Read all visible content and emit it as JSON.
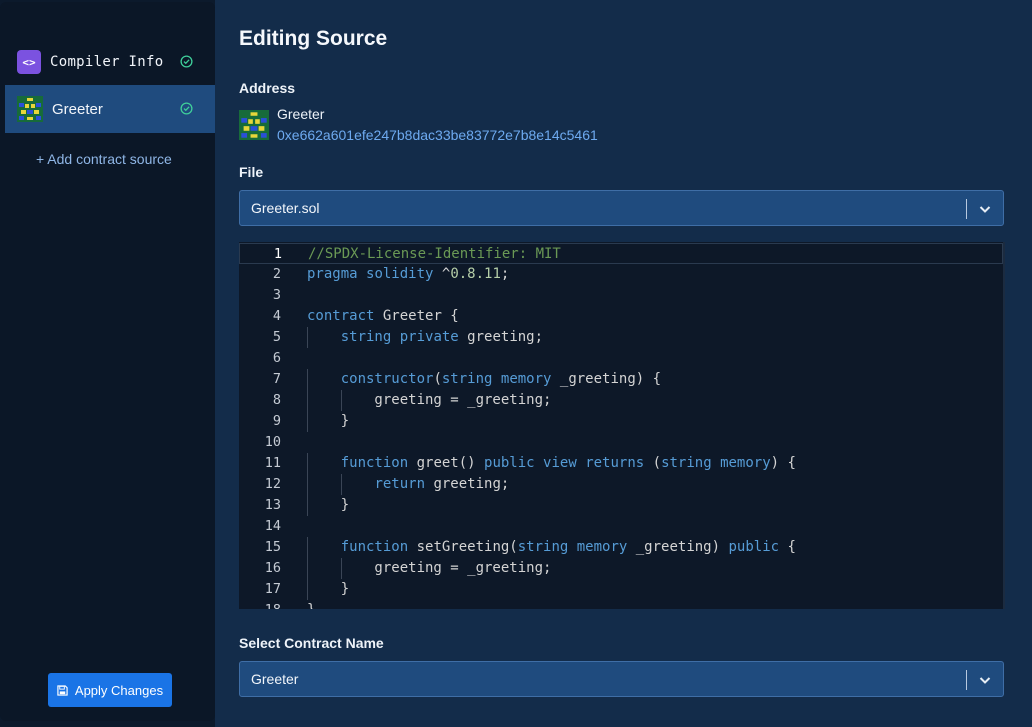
{
  "sidebar": {
    "items": [
      {
        "label": "Compiler Info",
        "icon": "code-brackets-icon",
        "status": "verified"
      },
      {
        "label": "Greeter",
        "icon": "identicon",
        "status": "verified"
      }
    ],
    "add_source": "+ Add contract source",
    "apply_label": "Apply Changes"
  },
  "main": {
    "title": "Editing Source",
    "address_label": "Address",
    "address_name": "Greeter",
    "address_hash": "0xe662a601efe247b8dac33be83772e7b8e14c5461",
    "file_label": "File",
    "file_value": "Greeter.sol",
    "contract_label": "Select Contract Name",
    "contract_value": "Greeter"
  },
  "editor": {
    "current_line": 1,
    "lines": [
      "//SPDX-License-Identifier: MIT",
      "pragma solidity ^0.8.11;",
      "",
      "contract Greeter {",
      "    string private greeting;",
      "",
      "    constructor(string memory _greeting) {",
      "        greeting = _greeting;",
      "    }",
      "",
      "    function greet() public view returns (string memory) {",
      "        return greeting;",
      "    }",
      "",
      "    function setGreeting(string memory _greeting) public {",
      "        greeting = _greeting;",
      "    }",
      "}"
    ]
  },
  "colors": {
    "accent": "#1a74e6",
    "selected": "#1f4b7e",
    "link": "#6eaaf0",
    "check": "#3fcf9a",
    "keyword": "#569cd6",
    "comment": "#6a9955",
    "number": "#b5cea8"
  }
}
